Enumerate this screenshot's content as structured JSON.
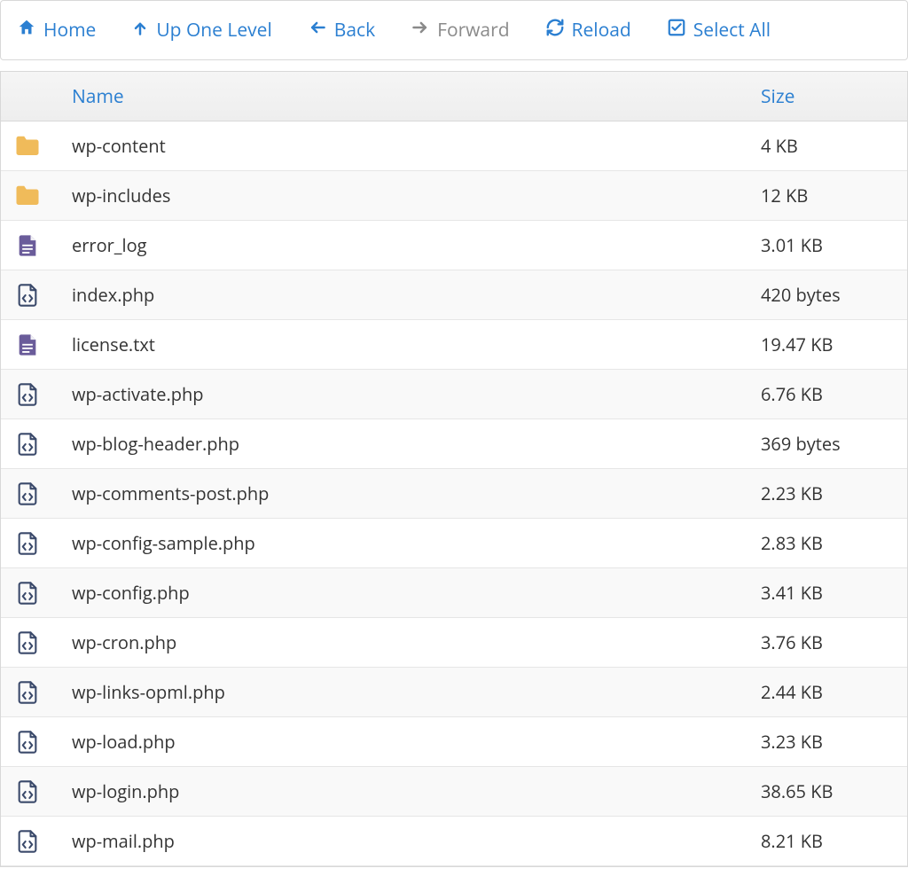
{
  "toolbar": {
    "home": "Home",
    "up": "Up One Level",
    "back": "Back",
    "forward": "Forward",
    "reload": "Reload",
    "select_all": "Select All"
  },
  "columns": {
    "name": "Name",
    "size": "Size"
  },
  "colors": {
    "link": "#2b7fd1",
    "disabled": "#8a8a8a",
    "folder": "#f0bb5a",
    "doc": "#6a5c9a",
    "code": "#3b4a6b"
  },
  "files": [
    {
      "icon": "folder",
      "name": "wp-content",
      "size": "4 KB"
    },
    {
      "icon": "folder",
      "name": "wp-includes",
      "size": "12 KB"
    },
    {
      "icon": "doc",
      "name": "error_log",
      "size": "3.01 KB"
    },
    {
      "icon": "code",
      "name": "index.php",
      "size": "420 bytes"
    },
    {
      "icon": "doc",
      "name": "license.txt",
      "size": "19.47 KB"
    },
    {
      "icon": "code",
      "name": "wp-activate.php",
      "size": "6.76 KB"
    },
    {
      "icon": "code",
      "name": "wp-blog-header.php",
      "size": "369 bytes"
    },
    {
      "icon": "code",
      "name": "wp-comments-post.php",
      "size": "2.23 KB"
    },
    {
      "icon": "code",
      "name": "wp-config-sample.php",
      "size": "2.83 KB"
    },
    {
      "icon": "code",
      "name": "wp-config.php",
      "size": "3.41 KB"
    },
    {
      "icon": "code",
      "name": "wp-cron.php",
      "size": "3.76 KB"
    },
    {
      "icon": "code",
      "name": "wp-links-opml.php",
      "size": "2.44 KB"
    },
    {
      "icon": "code",
      "name": "wp-load.php",
      "size": "3.23 KB"
    },
    {
      "icon": "code",
      "name": "wp-login.php",
      "size": "38.65 KB"
    },
    {
      "icon": "code",
      "name": "wp-mail.php",
      "size": "8.21 KB"
    }
  ]
}
